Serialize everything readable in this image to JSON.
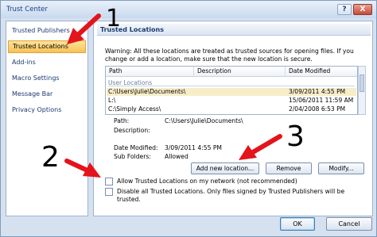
{
  "window": {
    "title": "Trust Center",
    "help_label": "?",
    "close_label": "X"
  },
  "sidebar": {
    "items": [
      {
        "label": "Trusted Publishers"
      },
      {
        "label": "Trusted Locations"
      },
      {
        "label": "Add-ins"
      },
      {
        "label": "Macro Settings"
      },
      {
        "label": "Message Bar"
      },
      {
        "label": "Privacy Options"
      }
    ]
  },
  "content": {
    "header": "Trusted Locations",
    "warning": "Warning: All these locations are treated as trusted sources for opening files. If you change or add a location, make sure that the new location is secure.",
    "table": {
      "columns": [
        "Path",
        "Description",
        "Date Modified"
      ],
      "group_label": "User Locations",
      "rows": [
        {
          "path": "C:\\Users\\Julie\\Documents\\",
          "description": "",
          "date": "3/09/2011 4:55 PM"
        },
        {
          "path": "L:\\",
          "description": "",
          "date": "15/06/2011 11:59 AM"
        },
        {
          "path": "C:\\Simply Access\\",
          "description": "",
          "date": "2/04/2008 6:53 PM"
        }
      ]
    },
    "details": {
      "path_label": "Path:",
      "path_value": "C:\\Users\\Julie\\Documents\\",
      "description_label": "Description:",
      "description_value": "",
      "date_label": "Date Modified:",
      "date_value": "3/09/2011 4:55 PM",
      "subfolders_label": "Sub Folders:",
      "subfolders_value": "Allowed"
    },
    "buttons": {
      "add": "Add new location...",
      "remove": "Remove",
      "modify": "Modify..."
    },
    "checkboxes": {
      "allow_network": "Allow Trusted Locations on my network (not recommended)",
      "disable_all": "Disable all Trusted Locations. Only files signed by Trusted Publishers will be trusted."
    }
  },
  "footer": {
    "ok": "OK",
    "cancel": "Cancel"
  },
  "callouts": {
    "one": "1",
    "two": "2",
    "three": "3"
  },
  "colors": {
    "arrow": "#e3141b",
    "selected_nav": "#f8c155",
    "header_text": "#1c3b70"
  }
}
